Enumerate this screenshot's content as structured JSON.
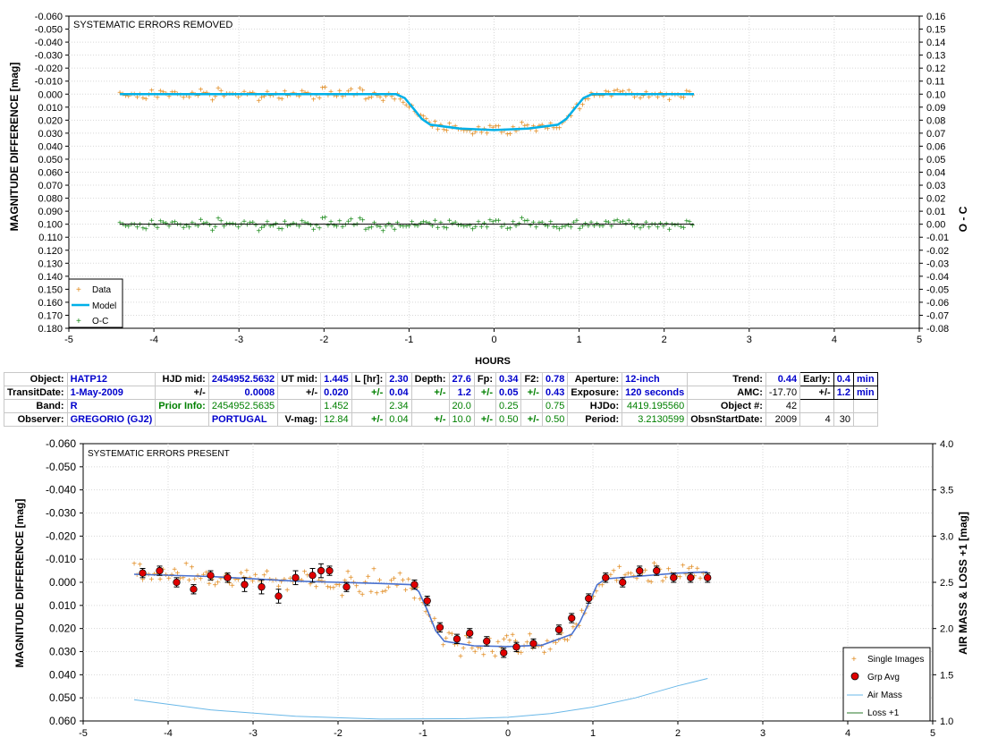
{
  "top_chart": {
    "annotation": "SYSTEMATIC ERRORS REMOVED",
    "ylabel_left": "MAGNITUDE DIFFERENCE [mag]",
    "ylabel_right": "O - C",
    "xlabel": "HOURS",
    "legend": [
      "Data",
      "Model",
      "O-C"
    ]
  },
  "bottom_chart": {
    "annotation": "SYSTEMATIC ERRORS PRESENT",
    "ylabel_left": "MAGNITUDE DIFFERENCE [mag]",
    "ylabel_right": "AIR MASS & LOSS +1 [mag]",
    "legend": [
      "Single Images",
      "Grp Avg",
      "Air Mass",
      "Loss +1"
    ]
  },
  "info_table": {
    "rows": [
      [
        {
          "t": "Object:",
          "c": "lbl"
        },
        {
          "t": "HATP12",
          "c": "bv"
        },
        {
          "t": "HJD mid:",
          "c": "lbl"
        },
        {
          "t": "2454952.5632",
          "c": "bvr"
        },
        {
          "t": "UT mid:",
          "c": "lbl"
        },
        {
          "t": "1.445",
          "c": "bvr"
        },
        {
          "t": "L [hr]:",
          "c": "lbl"
        },
        {
          "t": "2.30",
          "c": "bvr"
        },
        {
          "t": "Depth:",
          "c": "lbl"
        },
        {
          "t": "27.6",
          "c": "bvr"
        },
        {
          "t": "Fp:",
          "c": "lbl"
        },
        {
          "t": "0.34",
          "c": "bvr"
        },
        {
          "t": "F2:",
          "c": "lbl"
        },
        {
          "t": "0.78",
          "c": "bvr"
        },
        {
          "t": "Aperture:",
          "c": "lbl"
        },
        {
          "t": "12-inch",
          "c": "bv"
        },
        {
          "t": "Trend:",
          "c": "lbl"
        },
        {
          "t": "0.44",
          "c": "bvr"
        },
        {
          "t": "Early:",
          "c": "lbl bx"
        },
        {
          "t": "0.4",
          "c": "bvr bx"
        },
        {
          "t": "min",
          "c": "bv bx"
        }
      ],
      [
        {
          "t": "TransitDate:",
          "c": "lbl"
        },
        {
          "t": "1-May-2009",
          "c": "bv"
        },
        {
          "t": "+/-",
          "c": "lbl"
        },
        {
          "t": "0.0008",
          "c": "bvr"
        },
        {
          "t": "+/-",
          "c": "lbl"
        },
        {
          "t": "0.020",
          "c": "bvr"
        },
        {
          "t": "+/-",
          "c": "gl"
        },
        {
          "t": "0.04",
          "c": "bvr"
        },
        {
          "t": "+/-",
          "c": "gl"
        },
        {
          "t": "1.2",
          "c": "bvr"
        },
        {
          "t": "+/-",
          "c": "gl"
        },
        {
          "t": "0.05",
          "c": "bvr"
        },
        {
          "t": "+/-",
          "c": "gl"
        },
        {
          "t": "0.43",
          "c": "bvr"
        },
        {
          "t": "Exposure:",
          "c": "lbl"
        },
        {
          "t": "120 seconds",
          "c": "bv"
        },
        {
          "t": "AMC:",
          "c": "lbl"
        },
        {
          "t": "-17.70",
          "c": "kv"
        },
        {
          "t": "+/-",
          "c": "lbl bx"
        },
        {
          "t": "1.2",
          "c": "bvr bx"
        },
        {
          "t": "min",
          "c": "bv bx"
        }
      ],
      [
        {
          "t": "Band:",
          "c": "lbl"
        },
        {
          "t": "R",
          "c": "bv"
        },
        {
          "t": "Prior Info:",
          "c": "gl"
        },
        {
          "t": "2454952.5635",
          "c": "gv"
        },
        {
          "t": "",
          "c": "kv"
        },
        {
          "t": "1.452",
          "c": "gv"
        },
        {
          "t": "",
          "c": "kv"
        },
        {
          "t": "2.34",
          "c": "gv"
        },
        {
          "t": "",
          "c": "kv"
        },
        {
          "t": "20.0",
          "c": "gv"
        },
        {
          "t": "",
          "c": "kv"
        },
        {
          "t": "0.25",
          "c": "gv"
        },
        {
          "t": "",
          "c": "kv"
        },
        {
          "t": "0.75",
          "c": "gv"
        },
        {
          "t": "HJDo:",
          "c": "lbl"
        },
        {
          "t": "4419.195560",
          "c": "gv"
        },
        {
          "t": "Object #:",
          "c": "lbl"
        },
        {
          "t": "42",
          "c": "kv"
        },
        {
          "t": "",
          "c": "kv"
        },
        {
          "t": "",
          "c": "kv"
        },
        {
          "t": "",
          "c": "kv"
        }
      ],
      [
        {
          "t": "Observer:",
          "c": "lbl"
        },
        {
          "t": "GREGORIO (GJ2)",
          "c": "bv"
        },
        {
          "t": "",
          "c": "kv"
        },
        {
          "t": "PORTUGAL",
          "c": "bv"
        },
        {
          "t": "V-mag:",
          "c": "lbl"
        },
        {
          "t": "12.84",
          "c": "gv"
        },
        {
          "t": "+/-",
          "c": "gl"
        },
        {
          "t": "0.04",
          "c": "gv"
        },
        {
          "t": "+/-",
          "c": "gl"
        },
        {
          "t": "10.0",
          "c": "gv"
        },
        {
          "t": "+/-",
          "c": "gl"
        },
        {
          "t": "0.50",
          "c": "gv"
        },
        {
          "t": "+/-",
          "c": "gl"
        },
        {
          "t": "0.50",
          "c": "gv"
        },
        {
          "t": "Period:",
          "c": "lbl"
        },
        {
          "t": "3.2130599",
          "c": "gv"
        },
        {
          "t": "ObsnStartDate:",
          "c": "lbl"
        },
        {
          "t": "2009",
          "c": "kv"
        },
        {
          "t": "4",
          "c": "kv"
        },
        {
          "t": "30",
          "c": "kv"
        },
        {
          "t": "",
          "c": "kv"
        }
      ]
    ]
  },
  "colors": {
    "data": "#e08a1e",
    "model": "#00b0e8",
    "oc": "#1a8a1a",
    "grp_avg": "#e00000",
    "bottom_model": "#4a72d0",
    "airmass": "#6ab8e8",
    "loss": "#2a7a2a"
  },
  "chart_data": [
    {
      "type": "scatter",
      "title": "SYSTEMATIC ERRORS REMOVED",
      "xlabel": "HOURS",
      "ylabel": "MAGNITUDE DIFFERENCE [mag]",
      "y2label": "O - C",
      "xlim": [
        -5,
        5
      ],
      "ylim": [
        -0.06,
        0.18
      ],
      "y_inverted": true,
      "y2lim": [
        0.16,
        -0.08
      ],
      "xticks": [
        -5,
        -4,
        -3,
        -2,
        -1,
        0,
        1,
        2,
        3,
        4,
        5
      ],
      "transit": {
        "t1": -1.15,
        "t2": -0.75,
        "t3": 0.75,
        "t4": 1.15,
        "depth": 0.0276,
        "x_start": -4.4,
        "x_end": 2.35
      },
      "oc_offset": 0.1,
      "model_series": {
        "x": [
          -4.4,
          -3.0,
          -2.0,
          -1.15,
          -1.05,
          -0.95,
          -0.85,
          -0.75,
          -0.4,
          0.0,
          0.4,
          0.75,
          0.85,
          0.95,
          1.05,
          1.15,
          1.5,
          2.0,
          2.35
        ],
        "y": [
          0.0,
          0.0,
          0.0,
          0.0,
          0.003,
          0.011,
          0.019,
          0.0235,
          0.0265,
          0.0276,
          0.0265,
          0.0235,
          0.019,
          0.011,
          0.003,
          0.0,
          0.0,
          0.0,
          0.0
        ]
      },
      "legend": [
        "Data",
        "Model",
        "O-C"
      ],
      "grid": true,
      "legend_position": "bottom-left"
    },
    {
      "type": "scatter",
      "title": "SYSTEMATIC ERRORS PRESENT",
      "xlabel": "",
      "ylabel": "MAGNITUDE DIFFERENCE [mag]",
      "y2label": "AIR MASS & LOSS +1 [mag]",
      "xlim": [
        -5,
        5
      ],
      "ylim": [
        -0.06,
        0.06
      ],
      "y_inverted": true,
      "y2lim": [
        1.0,
        4.0
      ],
      "xticks": [
        -5,
        -4,
        -3,
        -2,
        -1,
        0,
        1,
        2,
        3,
        4,
        5
      ],
      "grp_avg": {
        "x": [
          -4.3,
          -4.1,
          -3.9,
          -3.7,
          -3.5,
          -3.3,
          -3.1,
          -2.9,
          -2.7,
          -2.5,
          -2.3,
          -2.2,
          -2.1,
          -1.9,
          -1.1,
          -0.95,
          -0.8,
          -0.6,
          -0.45,
          -0.25,
          -0.05,
          0.1,
          0.3,
          0.6,
          0.75,
          0.95,
          1.15,
          1.35,
          1.55,
          1.75,
          1.95,
          2.15,
          2.35
        ],
        "y": [
          -0.004,
          -0.005,
          0.0,
          0.003,
          -0.003,
          -0.002,
          0.001,
          0.002,
          0.006,
          -0.002,
          -0.003,
          -0.005,
          -0.005,
          0.002,
          0.001,
          0.008,
          0.0195,
          0.0245,
          0.022,
          0.0255,
          0.0305,
          0.028,
          0.0265,
          0.0205,
          0.0155,
          0.007,
          -0.002,
          0.0,
          -0.005,
          -0.005,
          -0.002,
          -0.002,
          -0.002
        ],
        "err": [
          0.002,
          0.002,
          0.002,
          0.002,
          0.002,
          0.002,
          0.003,
          0.003,
          0.003,
          0.003,
          0.003,
          0.003,
          0.002,
          0.002,
          0.002,
          0.002,
          0.002,
          0.002,
          0.002,
          0.002,
          0.002,
          0.002,
          0.002,
          0.002,
          0.002,
          0.002,
          0.002,
          0.002,
          0.002,
          0.002,
          0.002,
          0.002,
          0.002
        ]
      },
      "model_series": {
        "x": [
          -4.4,
          -3.5,
          -3.0,
          -2.5,
          -2.0,
          -1.5,
          -1.15,
          -1.05,
          -0.95,
          -0.85,
          -0.75,
          -0.4,
          0.0,
          0.4,
          0.75,
          0.85,
          0.95,
          1.05,
          1.15,
          1.5,
          2.0,
          2.35
        ],
        "y": [
          -0.0035,
          -0.0025,
          -0.0015,
          -0.0005,
          0.0,
          0.0005,
          0.001,
          0.004,
          0.012,
          0.021,
          0.0255,
          0.0275,
          0.0278,
          0.0272,
          0.0225,
          0.017,
          0.009,
          0.001,
          -0.0015,
          -0.0025,
          -0.004,
          -0.0045
        ]
      },
      "airmass": {
        "x": [
          -4.4,
          -3.5,
          -2.5,
          -1.5,
          -0.5,
          0.0,
          0.5,
          1.0,
          1.5,
          2.0,
          2.35
        ],
        "y": [
          1.23,
          1.12,
          1.05,
          1.02,
          1.025,
          1.04,
          1.08,
          1.15,
          1.25,
          1.38,
          1.46
        ]
      },
      "loss_plus1": {
        "x": [
          -4.4,
          2.35
        ],
        "y": [
          1.0,
          1.0
        ]
      },
      "legend": [
        "Single Images",
        "Grp Avg",
        "Air Mass",
        "Loss +1"
      ],
      "grid": true,
      "legend_position": "bottom-right"
    }
  ]
}
